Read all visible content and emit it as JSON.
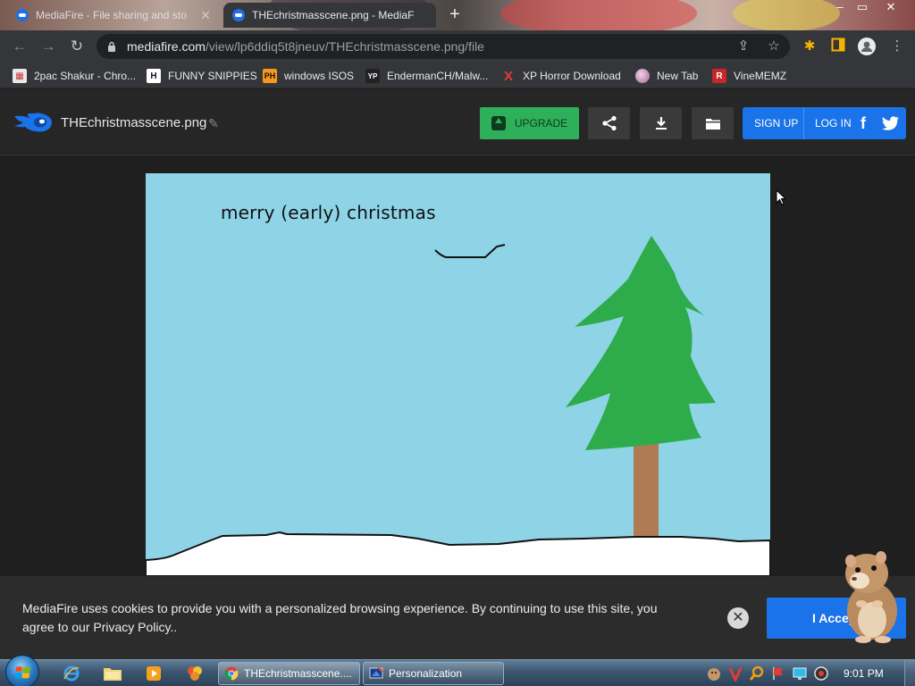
{
  "browser": {
    "tabs": [
      {
        "title": "MediaFire - File sharing and sto",
        "active": false
      },
      {
        "title": "THEchristmasscene.png - MediaF",
        "active": true
      }
    ],
    "new_tab": "+",
    "window_controls": {
      "minimize": "–",
      "maximize": "▭",
      "close": "✕"
    },
    "url": {
      "host": "mediafire.com",
      "path": "/view/lp6ddiq5t8jneuv/THEchristmasscene.png/file"
    },
    "bookmarks": [
      {
        "label": "2pac Shakur - Chro...",
        "icon": "calendar-icon",
        "icon_text": "",
        "icon_bg": "#e8e8e8",
        "icon_fg": "#c33"
      },
      {
        "label": "FUNNY SNIPPIES",
        "icon": "h-icon",
        "icon_text": "H",
        "icon_bg": "#ffffff",
        "icon_fg": "#111"
      },
      {
        "label": "windows ISOS",
        "icon": "ph-icon",
        "icon_text": "PH",
        "icon_bg": "#f7971d",
        "icon_fg": "#111"
      },
      {
        "label": "EndermanCH/Malw...",
        "icon": "yp-icon",
        "icon_text": "YP",
        "icon_bg": "#222",
        "icon_fg": "#fff"
      },
      {
        "label": "XP Horror Download",
        "icon": "x-icon",
        "icon_text": "X",
        "icon_bg": "transparent",
        "icon_fg": "#e53935"
      },
      {
        "label": "New Tab",
        "icon": "globe-icon",
        "icon_text": "",
        "icon_bg": "#d9a5c8",
        "icon_fg": "#333"
      },
      {
        "label": "VineMEMZ",
        "icon": "r-icon",
        "icon_text": "R",
        "icon_bg": "#c62828",
        "icon_fg": "#fff"
      }
    ]
  },
  "mediafire": {
    "filename": "THEchristmasscene.png",
    "upgrade_label": "UPGRADE",
    "sign_up_label": "SIGN UP",
    "log_in_label": "LOG IN",
    "facebook_glyph": "f",
    "brand_color": "#1a73e8",
    "upgrade_color": "#2eb05a"
  },
  "image": {
    "caption": "merry (early) christmas",
    "sky_color": "#8fd3e7",
    "tree_color": "#2eab4a",
    "trunk_color": "#b07a55",
    "snow_color": "#ffffff"
  },
  "cookie": {
    "text": "MediaFire uses cookies to provide you with a personalized browsing experience. By continuing to use this site, you agree to our Privacy Policy..",
    "accept_label": "I Accept",
    "close_glyph": "✕"
  },
  "taskbar": {
    "tasks": [
      {
        "label": "THEchristmasscene....",
        "icon": "chrome-icon",
        "active": true
      },
      {
        "label": "Personalization",
        "icon": "personalization-icon",
        "active": false
      }
    ],
    "clock": "9:01 PM"
  }
}
